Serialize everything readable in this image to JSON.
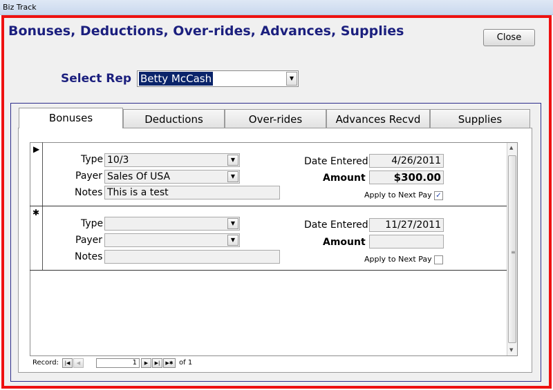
{
  "window": {
    "title": "Biz Track"
  },
  "form": {
    "title": "Bonuses, Deductions, Over-rides, Advances, Supplies",
    "close_label": "Close",
    "select_rep_label": "Select Rep",
    "selected_rep": "Betty McCash"
  },
  "tabs": [
    {
      "label": "Bonuses",
      "active": true
    },
    {
      "label": "Deductions",
      "active": false
    },
    {
      "label": "Over-rides",
      "active": false
    },
    {
      "label": "Advances Recvd",
      "active": false
    },
    {
      "label": "Supplies",
      "active": false
    }
  ],
  "labels": {
    "type": "Type",
    "payer": "Payer",
    "notes": "Notes",
    "date_entered": "Date Entered",
    "amount": "Amount",
    "apply_next_pay": "Apply to Next Pay"
  },
  "records": [
    {
      "selector": "▶",
      "type": "10/3",
      "payer": "Sales Of USA",
      "notes": "This is a test",
      "date_entered": "4/26/2011",
      "amount": "$300.00",
      "apply_next_pay": true,
      "check_mark": "✓"
    },
    {
      "selector": "✱",
      "type": "",
      "payer": "",
      "notes": "",
      "date_entered": "11/27/2011",
      "amount": "",
      "apply_next_pay": false,
      "check_mark": ""
    }
  ],
  "navigation": {
    "record_label": "Record:",
    "current": "1",
    "of_label": "of 1"
  },
  "icons": {
    "dropdown": "▼",
    "first": "|◀",
    "prev": "◀",
    "next": "▶",
    "last": "▶|",
    "new": "▶✱",
    "scroll_up": "▲",
    "scroll_down": "▼",
    "grip": "≡"
  },
  "colors": {
    "frame_border": "#ee1111",
    "title_color": "#1b1f7e",
    "selection_bg": "#0a246a"
  }
}
